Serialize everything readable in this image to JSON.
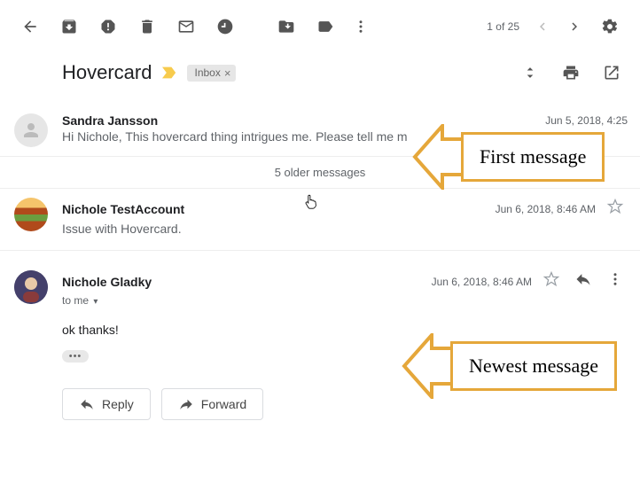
{
  "toolbar": {
    "pager": "1 of 25"
  },
  "subject": {
    "title": "Hovercard",
    "label": "Inbox"
  },
  "messages": {
    "first": {
      "sender": "Sandra Jansson",
      "date": "Jun 5, 2018, 4:25",
      "snippet": "Hi Nichole, This hovercard thing intrigues me. Please tell me m"
    },
    "olderText": "5 older messages",
    "second": {
      "sender": "Nichole TestAccount",
      "date": "Jun 6, 2018, 8:46 AM",
      "snippet": "Issue with Hovercard."
    },
    "third": {
      "sender": "Nichole Gladky",
      "date": "Jun 6, 2018, 8:46 AM",
      "to": "to me",
      "body": "ok thanks!"
    }
  },
  "actions": {
    "reply": "Reply",
    "forward": "Forward"
  },
  "annotations": {
    "first": "First message",
    "newest": "Newest message"
  }
}
